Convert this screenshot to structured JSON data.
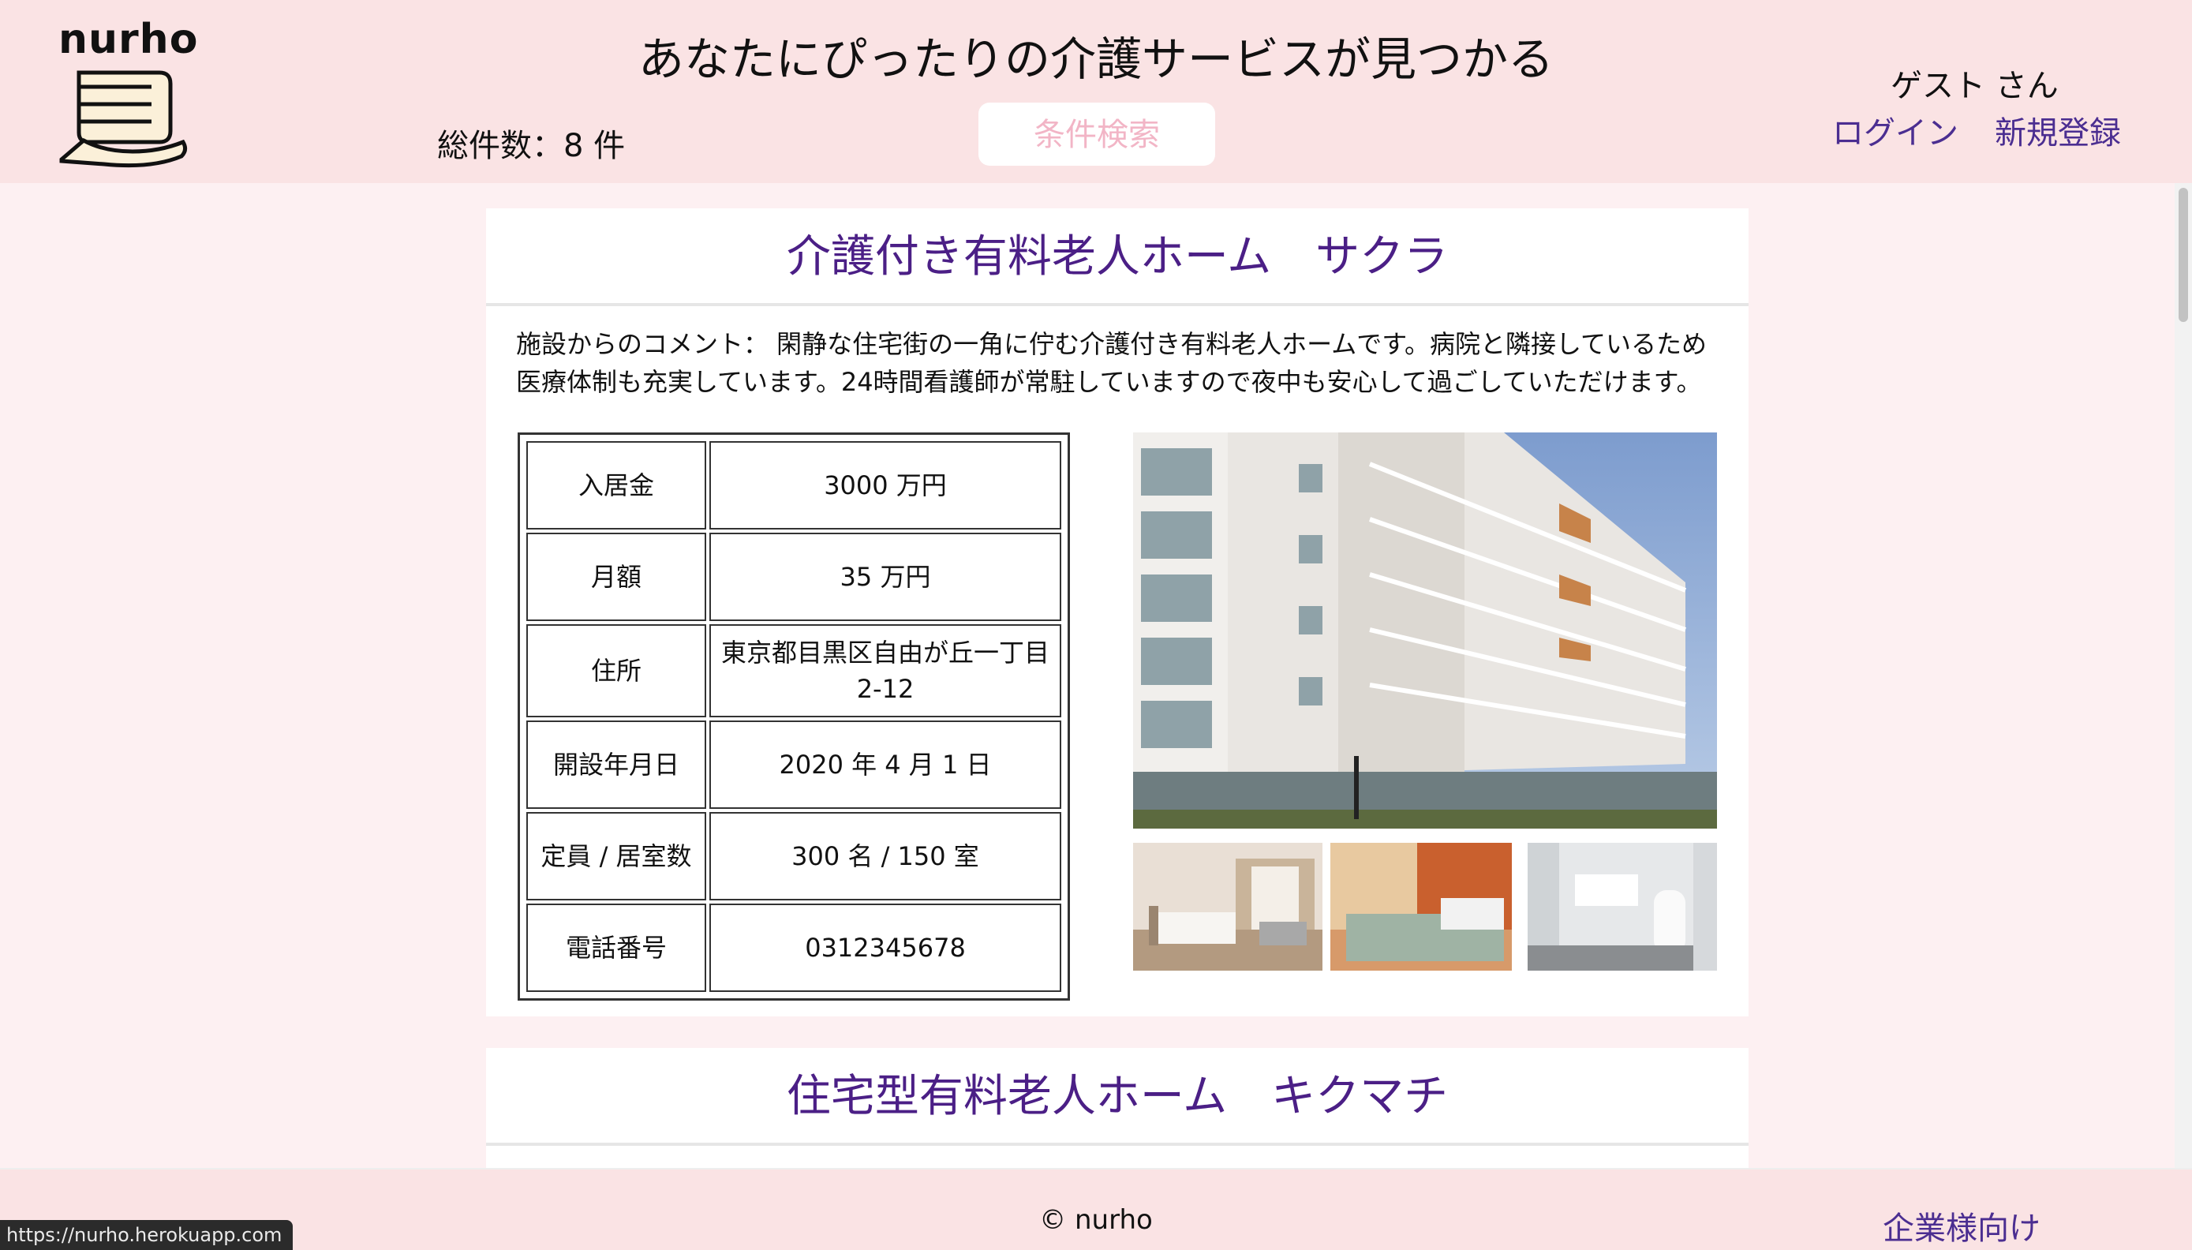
{
  "header": {
    "logo_text": "nurho",
    "site_title": "あなたにぴったりの介護サービスが見つかる",
    "total_count": "総件数：8 件",
    "search_button": "条件検索",
    "guest_label": "ゲスト さん",
    "login_link": "ログイン",
    "signup_link": "新規登録"
  },
  "facilities": [
    {
      "name": "介護付き有料老人ホーム　サクラ",
      "comment": "施設からのコメント： 閑静な住宅街の一角に佇む介護付き有料老人ホームです。病院と隣接しているため医療体制も充実しています。24時間看護師が常駐していますので夜中も安心して過ごしていただけます。",
      "details": [
        {
          "label": "入居金",
          "value": "3000 万円"
        },
        {
          "label": "月額",
          "value": "35 万円"
        },
        {
          "label": "住所",
          "value": "東京都目黒区自由が丘一丁目2-12"
        },
        {
          "label": "開設年月日",
          "value": "2020 年 4 月 1 日"
        },
        {
          "label": "定員 / 居室数",
          "value": "300 名 / 150 室"
        },
        {
          "label": "電話番号",
          "value": "0312345678"
        }
      ]
    },
    {
      "name": "住宅型有料老人ホーム　キクマチ"
    }
  ],
  "footer": {
    "copyright": "© nurho",
    "corporate_link": "企業様向け"
  },
  "status_bar": {
    "url": "https://nurho.herokuapp.com"
  }
}
